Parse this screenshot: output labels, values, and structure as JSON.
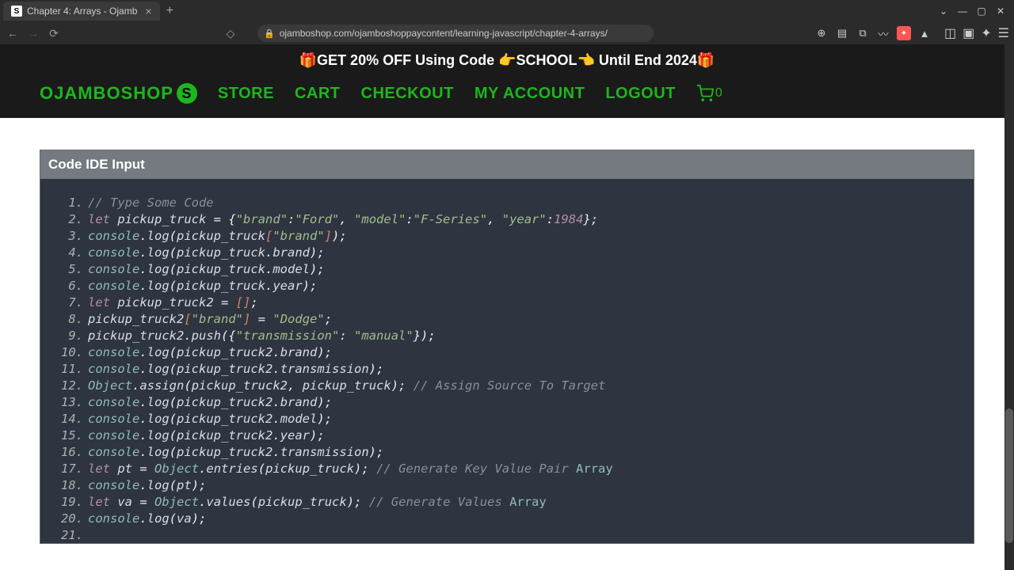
{
  "browser": {
    "tab_title": "Chapter 4: Arrays - Ojamb",
    "url": "ojamboshop.com/ojamboshoppaycontent/learning-javascript/chapter-4-arrays/",
    "window_min": "—",
    "window_max": "▢",
    "window_close": "✕",
    "chevron": "⌄"
  },
  "banner": "🎁GET 20% OFF Using Code 👉SCHOOL👈 Until End 2024🎁",
  "nav": {
    "logo": "OJAMBOSHOP",
    "logo_badge": "S",
    "items": [
      "STORE",
      "CART",
      "CHECKOUT",
      "MY ACCOUNT",
      "LOGOUT"
    ],
    "cart_count": "0"
  },
  "panel": {
    "title": "Code IDE Input"
  },
  "code": {
    "lines": [
      {
        "t": "com",
        "s": "// Type Some Code"
      },
      {
        "t": "raw",
        "s": "let pickup_truck = {\"brand\":\"Ford\", \"model\":\"F-Series\", \"year\":1984};"
      },
      {
        "t": "raw",
        "s": "console.log(pickup_truck[\"brand\"]);"
      },
      {
        "t": "raw",
        "s": "console.log(pickup_truck.brand);"
      },
      {
        "t": "raw",
        "s": "console.log(pickup_truck.model);"
      },
      {
        "t": "raw",
        "s": "console.log(pickup_truck.year);"
      },
      {
        "t": "raw",
        "s": "let pickup_truck2 = [];"
      },
      {
        "t": "raw",
        "s": "pickup_truck2[\"brand\"] = \"Dodge\";"
      },
      {
        "t": "raw",
        "s": "pickup_truck2.push({\"transmission\": \"manual\"});"
      },
      {
        "t": "raw",
        "s": "console.log(pickup_truck2.brand);"
      },
      {
        "t": "raw",
        "s": "console.log(pickup_truck2.transmission);"
      },
      {
        "t": "raw",
        "s": "Object.assign(pickup_truck2, pickup_truck); // Assign Source To Target"
      },
      {
        "t": "raw",
        "s": "console.log(pickup_truck2.brand);"
      },
      {
        "t": "raw",
        "s": "console.log(pickup_truck2.model);"
      },
      {
        "t": "raw",
        "s": "console.log(pickup_truck2.year);"
      },
      {
        "t": "raw",
        "s": "console.log(pickup_truck2.transmission);"
      },
      {
        "t": "raw",
        "s": "let pt = Object.entries(pickup_truck); // Generate Key Value Pair Array"
      },
      {
        "t": "raw",
        "s": "console.log(pt);"
      },
      {
        "t": "raw",
        "s": "let va = Object.values(pickup_truck); // Generate Values Array"
      },
      {
        "t": "raw",
        "s": "console.log(va);"
      },
      {
        "t": "raw",
        "s": ""
      }
    ]
  }
}
